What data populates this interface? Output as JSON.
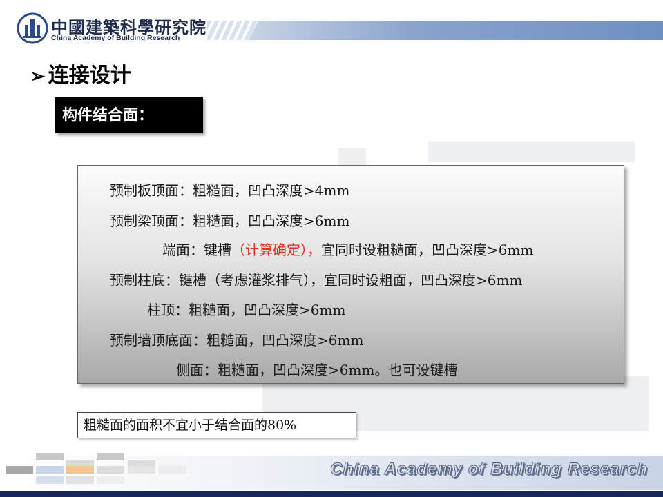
{
  "header": {
    "logo_cn": "中國建築科學研究院",
    "logo_en": "China Academy of Building Research"
  },
  "title": {
    "arrow": "➢",
    "text": "连接设计"
  },
  "section_label": "构件结合面：",
  "content": {
    "line1": "预制板顶面：粗糙面，凹凸深度>4mm",
    "line2": "预制梁顶面：粗糙面，凹凸深度>6mm",
    "line3_pre": "端面：键槽",
    "line3_red": "（计算确定），",
    "line3_post": "宜同时设粗糙面，凹凸深度>6mm",
    "line4": "预制柱底：键槽（考虑灌浆排气），宜同时设粗面，凹凸深度>6mm",
    "line5": "柱顶：粗糙面，凹凸深度>6mm",
    "line6": "预制墙顶底面：粗糙面，凹凸深度>6mm",
    "line7": "侧面：粗糙面，凹凸深度>6mm。也可设键槽"
  },
  "note": "粗糙面的面积不宜小于结合面的80%",
  "footer": {
    "text": "China Academy of Building Research"
  },
  "colors": {
    "accent_red": "#e0301e",
    "navy": "#17275c",
    "header_blue": "#6f8fc2"
  }
}
